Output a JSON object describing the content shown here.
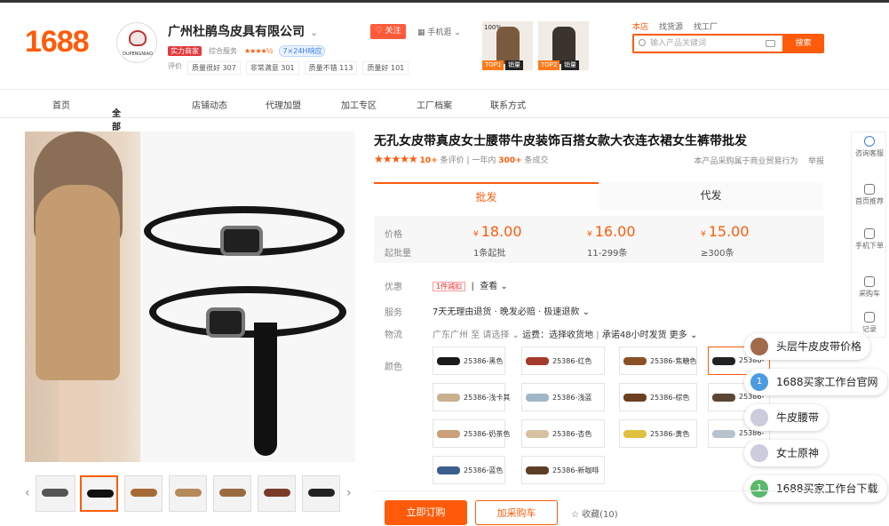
{
  "logo": "1688",
  "shop": {
    "logo_text": "DUPENGNIAO",
    "name": "广州杜鹃鸟皮具有限公司",
    "follow": "关注",
    "mobile": "手机逛",
    "badge_strength": "实力商家",
    "service_label": "综合服务",
    "stars": "★★★★½",
    "badge_online": "7×24H响应",
    "rating_label": "评价",
    "ratings": [
      "质量很好 307",
      "非常满意 301",
      "质量不错 113",
      "质量好 101"
    ]
  },
  "promo": {
    "item1_label": "100%",
    "item1_tag": "TOP1",
    "item1_tag2": "销量",
    "item2_tag": "TOP2",
    "item2_tag2": "销量"
  },
  "search": {
    "tabs": [
      "本店",
      "找货源",
      "找工厂"
    ],
    "placeholder": "输入产品关键词",
    "button": "搜索"
  },
  "nav": [
    "首页",
    "全部商品",
    "店铺动态",
    "代理加盟",
    "加工专区",
    "工厂档案",
    "联系方式"
  ],
  "product": {
    "title": "无孔女皮带真皮女士腰带牛皮装饰百搭女款大衣连衣裙女生裤带批发",
    "stars": "★★★★★",
    "reviews_count": "10+",
    "reviews_label": "条评价",
    "sold_prefix": "一年内",
    "sold_count": "300+",
    "sold_suffix": "条成交",
    "right_note": "本产品采购属于商业贸易行为",
    "report": "举报"
  },
  "tabs": [
    "批发",
    "代发"
  ],
  "pricing": {
    "price_label": "价格",
    "qty_label": "起批量",
    "currency": "¥",
    "tiers": [
      {
        "price": "18.00",
        "qty": "1条起批"
      },
      {
        "price": "16.00",
        "qty": "11-299条"
      },
      {
        "price": "15.00",
        "qty": "≥300条"
      }
    ]
  },
  "details": {
    "promo_label": "优惠",
    "promo_tag": "1件減扣",
    "promo_link": "查看",
    "service_label": "服务",
    "service_value": "7天无理由退货 · 晚发必赔 · 极速退款",
    "logistics_label": "物流",
    "logistics_from": "广东广州",
    "logistics_to": "至",
    "logistics_select": "请选择",
    "logistics_fee": "运费：选择收货地",
    "logistics_promise": "承诺48小时发货",
    "logistics_more": "更多",
    "color_label": "颜色"
  },
  "skus": [
    {
      "label": "25386-黑色",
      "color": "#1b1b1b"
    },
    {
      "label": "25386-红色",
      "color": "#a33a2c"
    },
    {
      "label": "25386-焦糖色",
      "color": "#8a5128"
    },
    {
      "label": "25386-",
      "color": "#222"
    },
    {
      "label": "25386-浅卡其",
      "color": "#c9b08e"
    },
    {
      "label": "25386-浅蓝",
      "color": "#9fb6c9"
    },
    {
      "label": "25386-棕色",
      "color": "#6b3f1f"
    },
    {
      "label": "25386-",
      "color": "#5a4634"
    },
    {
      "label": "25386-奶茶色",
      "color": "#c9a07a"
    },
    {
      "label": "25386-杏色",
      "color": "#d6c1a3"
    },
    {
      "label": "25386-黄色",
      "color": "#e0c040"
    },
    {
      "label": "25386-",
      "color": "#b8c2cc"
    },
    {
      "label": "25386-蓝色",
      "color": "#3b5e8c"
    },
    {
      "label": "25386-新咖啡",
      "color": "#5e3d27"
    }
  ],
  "sidebar": [
    "咨询客服",
    "首页推荐",
    "手机下单",
    "采购车",
    "记录"
  ],
  "floats": [
    {
      "text": "头层牛皮皮带价格",
      "icon": ""
    },
    {
      "text": "1688买家工作台官网",
      "icon": "1"
    },
    {
      "text": "牛皮腰带",
      "icon": ""
    },
    {
      "text": "女士原神",
      "icon": ""
    },
    {
      "text": "1688买家工作台下载",
      "icon": "1"
    }
  ],
  "actions": {
    "buy": "立即订购",
    "cart": "加采购车",
    "fav": "收藏(10)"
  },
  "colors": {
    "brand": "#ff5b0a"
  }
}
